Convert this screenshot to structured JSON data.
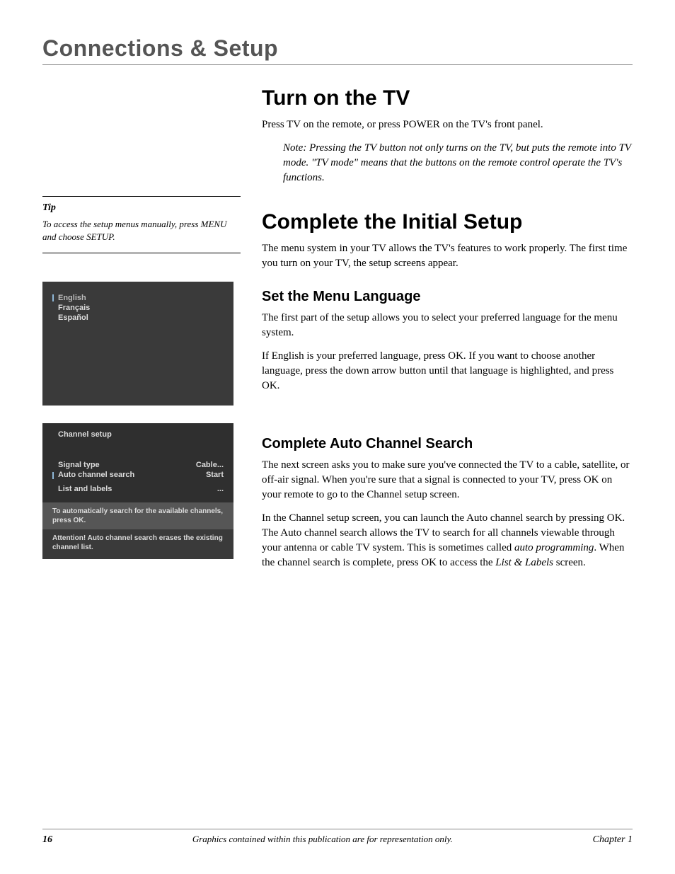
{
  "header": "Connections & Setup",
  "section1": {
    "title": "Turn on the TV",
    "p1": "Press TV on the remote, or press POWER on the TV's front panel.",
    "note": "Note: Pressing the TV button not only turns on the TV, but puts the remote into TV mode. \"TV mode\" means that the buttons on the remote control operate the TV's functions."
  },
  "section2": {
    "title": "Complete the Initial Setup",
    "p1": "The menu system in your TV allows the TV's features to work properly. The first time you turn on your TV, the setup screens appear."
  },
  "section3": {
    "title": "Set the Menu Language",
    "p1": "The first part of the setup allows you to select your preferred language for the menu system.",
    "p2": "If English is your preferred language, press OK. If you want to choose another language, press the down arrow button until that language is highlighted, and press OK."
  },
  "section4": {
    "title": "Complete Auto Channel Search",
    "p1": "The next screen asks you to make sure you've connected the TV to a cable, satellite, or off-air signal. When you're sure that a signal is connected to your TV, press OK on your remote to go to the Channel setup screen.",
    "p2_a": "In the Channel setup screen, you can launch the Auto channel search by pressing OK. The Auto channel search allows the TV to search for all channels viewable through your antenna or cable TV system. This is sometimes called ",
    "p2_ital1": "auto programming",
    "p2_b": ". When the channel search is complete, press OK to access the ",
    "p2_ital2": "List & Labels",
    "p2_c": " screen."
  },
  "tip": {
    "label": "Tip",
    "text": "To access the setup menus manually, press MENU and choose SETUP."
  },
  "langMenu": {
    "items": [
      "English",
      "Français",
      "Español"
    ],
    "selectedIndex": 0
  },
  "chanMenu": {
    "title": "Channel setup",
    "rows": [
      {
        "label": "Signal type",
        "value": "Cable..."
      },
      {
        "label": "Auto channel search",
        "value": "Start"
      },
      {
        "label": "List and labels",
        "value": "..."
      }
    ],
    "selectedIndex": 1,
    "help": "To automatically search for the available channels, press OK.",
    "warn": "Attention! Auto channel search erases the existing channel list."
  },
  "footer": {
    "page": "16",
    "center": "Graphics contained within this publication are for representation only.",
    "right": "Chapter 1"
  }
}
